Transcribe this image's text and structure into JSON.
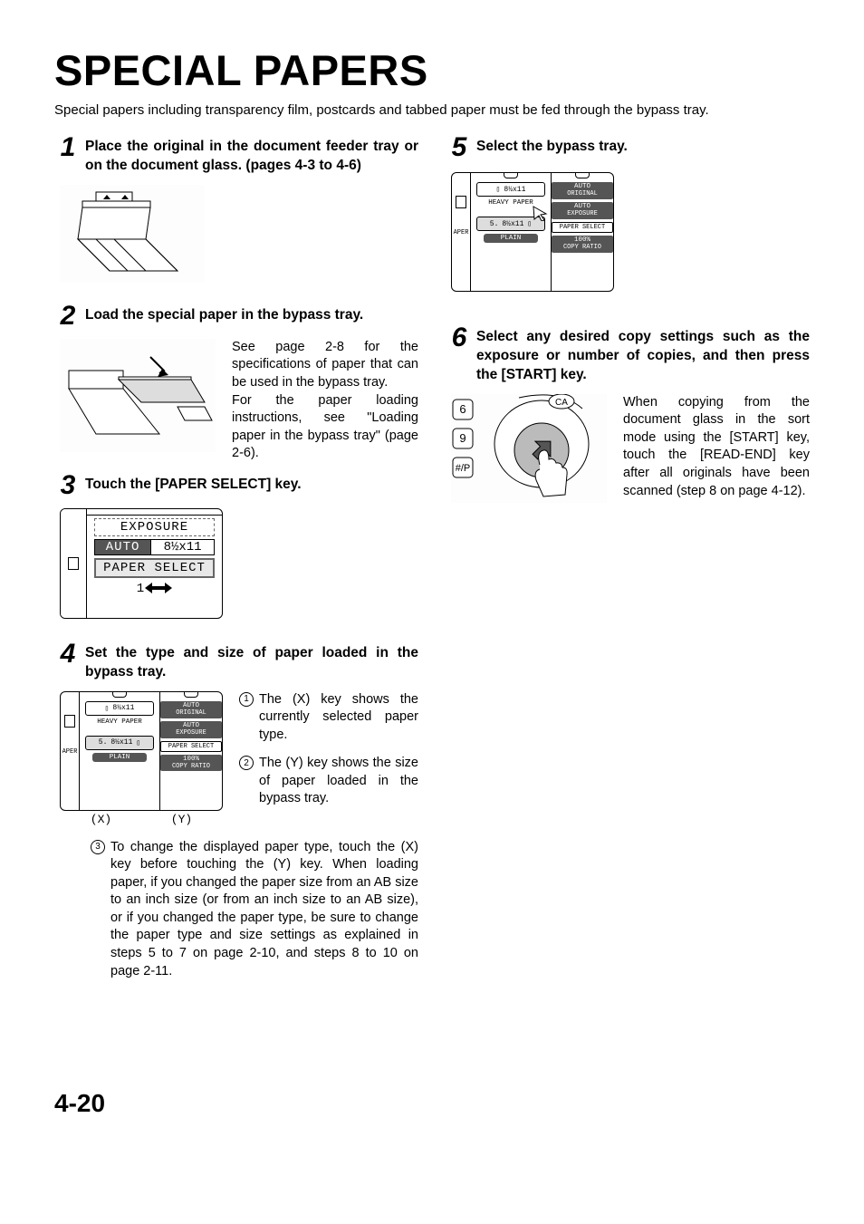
{
  "title": "SPECIAL PAPERS",
  "intro": "Special papers including transparency film, postcards and tabbed paper must be fed through the bypass tray.",
  "page_number": "4-20",
  "steps": {
    "s1": {
      "num": "1",
      "title": "Place the original in the document feeder tray or on the document glass. (pages 4-3 to 4-6)"
    },
    "s2": {
      "num": "2",
      "title": "Load the special paper in the bypass tray.",
      "body1": "See page 2-8 for the specifications of paper that can be used in the bypass tray.",
      "body2": "For the paper loading instructions, see \"Loading paper in the bypass tray\" (page 2-6)."
    },
    "s3": {
      "num": "3",
      "title": "Touch the [PAPER SELECT] key.",
      "panel": {
        "r1": "EXPOSURE",
        "r2a": "AUTO",
        "r2b": "8½x11",
        "r3": "PAPER SELECT",
        "r4": "1"
      }
    },
    "s4": {
      "num": "4",
      "title": "Set the type and size of paper loaded in the bypass tray.",
      "panel": {
        "left1": "APER",
        "mid1a": "8½x11",
        "mid1b": "HEAVY PAPER",
        "mid2a": "5.",
        "mid2b": "8½x11",
        "mid2c": "PLAIN",
        "r1a": "AUTO",
        "r1b": "ORIGINAL",
        "r2a": "AUTO",
        "r2b": "EXPOSURE",
        "r3": "PAPER SELECT",
        "r4a": "100%",
        "r4b": "COPY RATIO",
        "x": "(X)",
        "y": "(Y)"
      },
      "item1": "The (X) key shows the currently selected paper type.",
      "item2": "The (Y) key shows the size of paper loaded in the bypass tray.",
      "item3": "To change the displayed paper type, touch the (X) key before touching the (Y) key. When loading paper, if you changed the paper size from an AB size to an inch size (or from an inch size to an AB size), or if you changed the paper type, be sure to change the paper type and size settings as explained in steps 5 to 7 on page 2-10, and steps 8 to 10 on page 2-11."
    },
    "s5": {
      "num": "5",
      "title": "Select the bypass tray.",
      "panel": {
        "left1": "APER",
        "mid1a": "8½x11",
        "mid1b": "HEAVY PAPER",
        "mid2a": "5.",
        "mid2b": "8½x11",
        "mid2c": "PLAIN",
        "r1a": "AUTO",
        "r1b": "ORIGINAL",
        "r2a": "AUTO",
        "r2b": "EXPOSURE",
        "r3": "PAPER SELECT",
        "r4a": "100%",
        "r4b": "COPY RATIO"
      }
    },
    "s6": {
      "num": "6",
      "title": "Select any desired copy settings such as the exposure or number of copies, and then press the [START] key.",
      "keys": {
        "k1": "6",
        "k2": "9",
        "k3": "#/P",
        "ca": "CA"
      },
      "body": "When copying from the document glass in the sort mode using the [START] key, touch the [READ-END] key after all originals have been scanned (step 8 on page 4-12)."
    }
  },
  "circles": {
    "c1": "1",
    "c2": "2",
    "c3": "3"
  }
}
